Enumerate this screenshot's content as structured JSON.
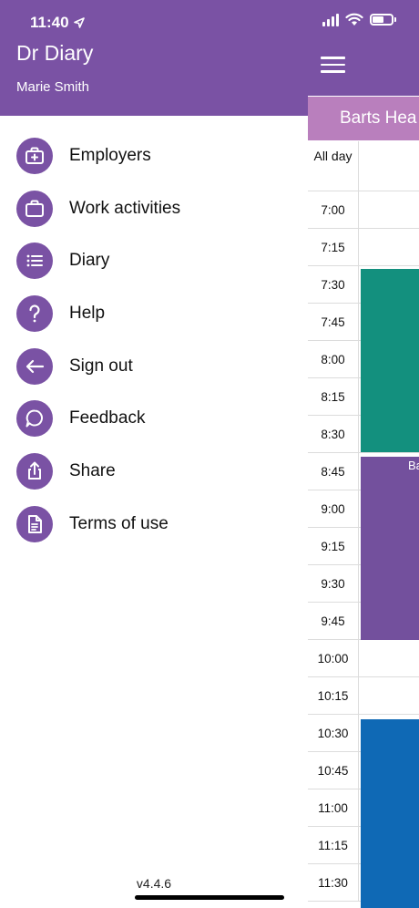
{
  "status_bar": {
    "time": "11:40"
  },
  "drawer": {
    "title": "Dr Diary",
    "user_name": "Marie Smith",
    "items": [
      {
        "label": "Employers",
        "icon": "briefcase-plus-icon"
      },
      {
        "label": "Work activities",
        "icon": "briefcase-icon"
      },
      {
        "label": "Diary",
        "icon": "list-icon"
      },
      {
        "label": "Help",
        "icon": "question-icon"
      },
      {
        "label": "Sign out",
        "icon": "arrow-left-icon"
      },
      {
        "label": "Feedback",
        "icon": "chat-bubble-icon"
      },
      {
        "label": "Share",
        "icon": "share-icon"
      },
      {
        "label": "Terms of use",
        "icon": "document-icon"
      }
    ],
    "version": "v4.4.6"
  },
  "calendar": {
    "tab_label": "Barts Hea",
    "all_day_label": "All day",
    "time_slots": [
      "7:00",
      "7:15",
      "7:30",
      "7:45",
      "8:00",
      "8:15",
      "8:30",
      "8:45",
      "9:00",
      "9:15",
      "9:30",
      "9:45",
      "10:00",
      "10:15",
      "10:30",
      "10:45",
      "11:00",
      "11:15",
      "11:30"
    ],
    "event_label": "Ba"
  },
  "colors": {
    "primary": "#7a52a4",
    "tab": "#b97fbd",
    "event_teal": "#13907e",
    "event_purple": "#73509d",
    "event_blue": "#0f69b5"
  }
}
